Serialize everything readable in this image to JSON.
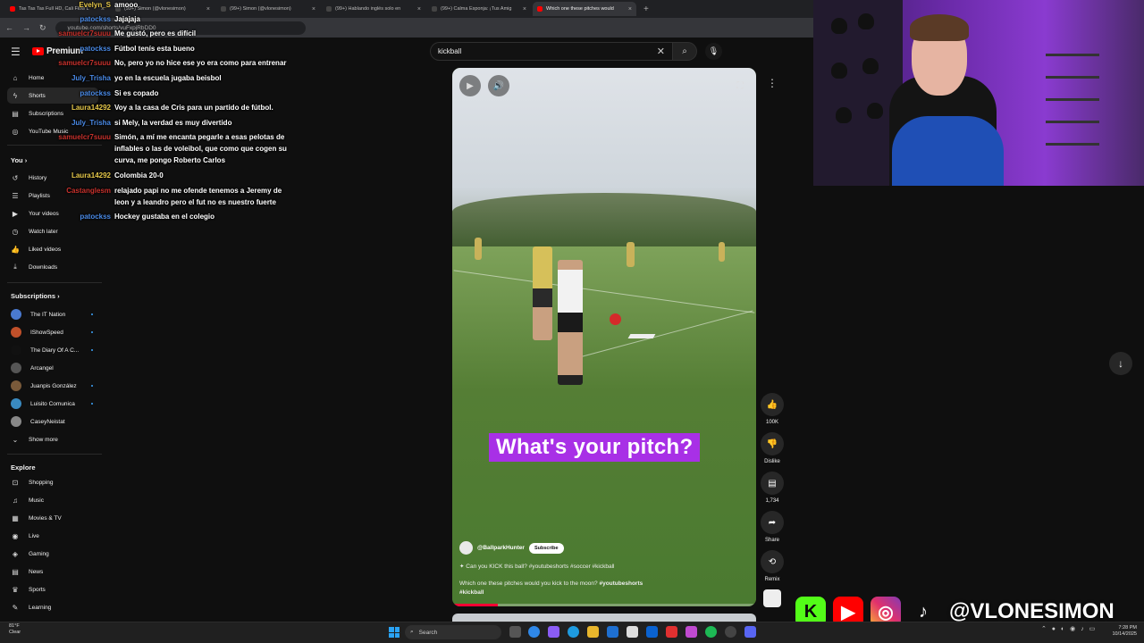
{
  "browser": {
    "tabs": [
      {
        "label": "Tas Tas Tas Full HD, Cali Flow L",
        "color": "#ff0000",
        "active": false
      },
      {
        "label": "(99+) Simon (@vlonesimon)",
        "color": "#444444",
        "active": false
      },
      {
        "label": "(99+) Simon (@vlonesimon)",
        "color": "#444444",
        "active": false
      },
      {
        "label": "(99+) Hablando inglés solo en",
        "color": "#444444",
        "active": false
      },
      {
        "label": "(99+) Calma Esponja: ¡Tus Amig",
        "color": "#444444",
        "active": false
      },
      {
        "label": "Which one these pitches would",
        "color": "#ff0000",
        "active": true
      }
    ],
    "url": "youtube.com/shorts/vuFxpjRbDD0"
  },
  "header": {
    "logo_text": "Premium",
    "search_value": "kickball"
  },
  "sidebar": {
    "main": [
      {
        "label": "Home",
        "icon": "home-icon",
        "glyph": "⌂"
      },
      {
        "label": "Shorts",
        "icon": "shorts-icon",
        "glyph": "ϟ",
        "active": true
      },
      {
        "label": "Subscriptions",
        "icon": "subscriptions-icon",
        "glyph": "▤"
      },
      {
        "label": "YouTube Music",
        "icon": "music-icon",
        "glyph": "◎"
      }
    ],
    "you_title": "You",
    "you": [
      {
        "label": "History",
        "icon": "history-icon",
        "glyph": "↺"
      },
      {
        "label": "Playlists",
        "icon": "playlists-icon",
        "glyph": "☰"
      },
      {
        "label": "Your videos",
        "icon": "your-videos-icon",
        "glyph": "▶"
      },
      {
        "label": "Watch later",
        "icon": "watch-later-icon",
        "glyph": "◷"
      },
      {
        "label": "Liked videos",
        "icon": "liked-icon",
        "glyph": "👍"
      },
      {
        "label": "Downloads",
        "icon": "downloads-icon",
        "glyph": "⤓"
      }
    ],
    "subs_title": "Subscriptions",
    "subs": [
      {
        "label": "The IT Nation",
        "color": "#4a7ad0",
        "dot": true
      },
      {
        "label": "IShowSpeed",
        "color": "#c0502a",
        "dot": true
      },
      {
        "label": "The Diary Of A C...",
        "color": "#111111",
        "dot": true
      },
      {
        "label": "Arcangel",
        "color": "#555555",
        "dot": false
      },
      {
        "label": "Juanpis González",
        "color": "#7a5a3a",
        "dot": true
      },
      {
        "label": "Luisito Comunica",
        "color": "#3a8ac0",
        "dot": true
      },
      {
        "label": "CaseyNeistat",
        "color": "#888888",
        "dot": false
      }
    ],
    "show_more": "Show more",
    "explore_title": "Explore",
    "explore": [
      {
        "label": "Shopping",
        "icon": "shopping-icon",
        "glyph": "⊡"
      },
      {
        "label": "Music",
        "icon": "music-note-icon",
        "glyph": "♫"
      },
      {
        "label": "Movies & TV",
        "icon": "movies-icon",
        "glyph": "▦"
      },
      {
        "label": "Live",
        "icon": "live-icon",
        "glyph": "◉"
      },
      {
        "label": "Gaming",
        "icon": "gaming-icon",
        "glyph": "◈"
      },
      {
        "label": "News",
        "icon": "news-icon",
        "glyph": "▤"
      },
      {
        "label": "Sports",
        "icon": "sports-icon",
        "glyph": "♛"
      },
      {
        "label": "Learning",
        "icon": "learning-icon",
        "glyph": "✎"
      }
    ]
  },
  "chat": [
    {
      "name": "Evelyn_S",
      "color": "#e6c84a",
      "msg": "amooo"
    },
    {
      "name": "patockss",
      "color": "#4a8ae6",
      "msg": "Jajajaja"
    },
    {
      "name": "samuelcr7suuu",
      "color": "#c8322d",
      "msg": "Me gustó, pero es difícil"
    },
    {
      "name": "patockss",
      "color": "#4a8ae6",
      "msg": "Fútbol tenís esta bueno"
    },
    {
      "name": "samuelcr7suuu",
      "color": "#c8322d",
      "msg": "No, pero yo no hice ese yo era como para entrenar"
    },
    {
      "name": "July_Trisha",
      "color": "#4a8ae6",
      "msg": "yo en la escuela jugaba beisbol"
    },
    {
      "name": "patockss",
      "color": "#4a8ae6",
      "msg": "Si es copado"
    },
    {
      "name": "Laura14292",
      "color": "#e6c84a",
      "msg": "Voy a la casa de Cris para un partido de fútbol."
    },
    {
      "name": "July_Trisha",
      "color": "#4a8ae6",
      "msg": "si Mely, la verdad es muy divertido"
    },
    {
      "name": "samuelcr7suuu",
      "color": "#c8322d",
      "msg": "Simón, a mí me encanta pegarle a esas pelotas de inflables o las de voleibol, que como que cogen su curva, me pongo Roberto Carlos"
    },
    {
      "name": "Laura14292",
      "color": "#e6c84a",
      "msg": "Colombia 20-0"
    },
    {
      "name": "Castanglesm",
      "color": "#c8322d",
      "msg": "relajado papi no me ofende tenemos a Jeremy de leon y a leandro pero el fut no es nuestro fuerte"
    },
    {
      "name": "patockss",
      "color": "#4a8ae6",
      "msg": "Hockey gustaba en el colegio"
    }
  ],
  "video": {
    "overlay_text": "What's your pitch?",
    "channel": "@BallparkHunter",
    "subscribe": "Subscribe",
    "line1": "Can you KICK this ball? #youtubeshorts #soccer #kickball",
    "line2": "Which one these pitches would you kick to the moon?",
    "line2_tags": "#youtubeshorts #kickball",
    "progress": 0.15
  },
  "actions": {
    "like": "100K",
    "dislike": "Dislike",
    "comments": "1,734",
    "share": "Share",
    "remix": "Remix"
  },
  "overlay": {
    "handle": "@VLONESIMON"
  },
  "taskbar": {
    "weather_temp": "81°F",
    "weather_desc": "Clear",
    "search": "Search",
    "time": "7:28 PM",
    "date": "10/14/2025"
  }
}
